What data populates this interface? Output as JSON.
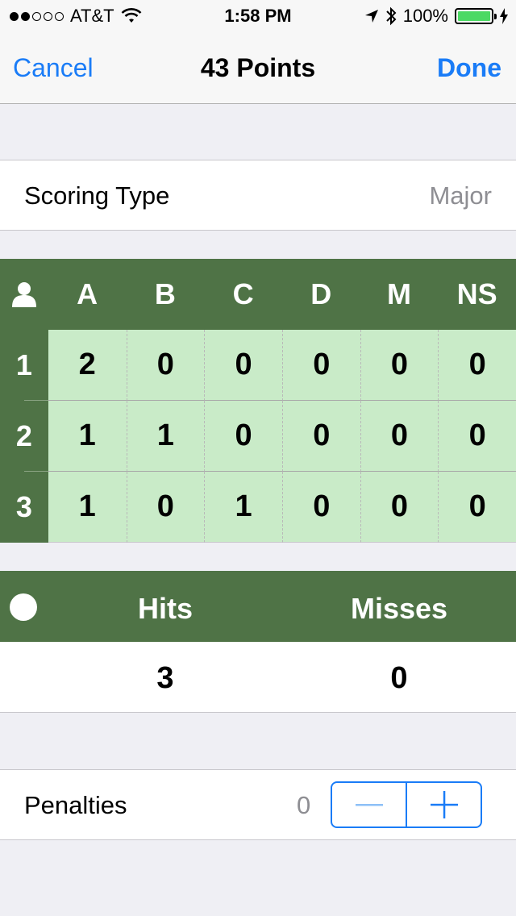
{
  "status_bar": {
    "carrier": "AT&T",
    "time": "1:58 PM",
    "battery": "100%",
    "signal_dots_filled": 2,
    "signal_dots_total": 5,
    "battery_color": "#4cd964"
  },
  "nav": {
    "cancel_label": "Cancel",
    "title": "43 Points",
    "done_label": "Done",
    "accent_color": "#1a7cf7"
  },
  "scoring": {
    "label": "Scoring Type",
    "value": "Major"
  },
  "score_table": {
    "header_icon": "person-icon",
    "columns": [
      "A",
      "B",
      "C",
      "D",
      "M",
      "NS"
    ],
    "rows": [
      {
        "label": "1",
        "values": [
          "2",
          "0",
          "0",
          "0",
          "0",
          "0"
        ]
      },
      {
        "label": "2",
        "values": [
          "1",
          "1",
          "0",
          "0",
          "0",
          "0"
        ]
      },
      {
        "label": "3",
        "values": [
          "1",
          "0",
          "1",
          "0",
          "0",
          "0"
        ]
      }
    ],
    "header_color": "#4f7346",
    "cell_color": "#c9ebc8"
  },
  "hits_table": {
    "header_icon": "circle-icon",
    "hits_label": "Hits",
    "misses_label": "Misses",
    "hits_value": "3",
    "misses_value": "0"
  },
  "penalties": {
    "label": "Penalties",
    "value": "0",
    "minus_symbol": "—",
    "plus_symbol": "+"
  }
}
